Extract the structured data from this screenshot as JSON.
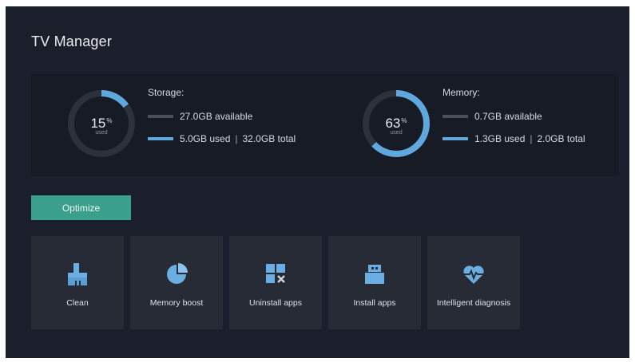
{
  "header": {
    "title": "TV Manager"
  },
  "storage": {
    "percent": "15",
    "percent_unit": "%",
    "used_label": "used",
    "fraction": 0.15,
    "heading": "Storage:",
    "available": "27.0GB available",
    "used": "5.0GB used",
    "separator": "|",
    "total": "32.0GB total"
  },
  "memory": {
    "percent": "63",
    "percent_unit": "%",
    "used_label": "used",
    "fraction": 0.63,
    "heading": "Memory:",
    "available": "0.7GB available",
    "used": "1.3GB used",
    "separator": "|",
    "total": "2.0GB total"
  },
  "actions": {
    "optimize_label": "Optimize"
  },
  "tiles": [
    {
      "label": "Clean",
      "icon": "broom-icon"
    },
    {
      "label": "Memory boost",
      "icon": "pie-chart-icon"
    },
    {
      "label": "Uninstall apps",
      "icon": "uninstall-grid-icon"
    },
    {
      "label": "Install apps",
      "icon": "usb-drive-icon"
    },
    {
      "label": "Intelligent diagnosis",
      "icon": "heart-pulse-icon"
    }
  ],
  "colors": {
    "background": "#1b1f2b",
    "panel": "#171b26",
    "tile": "#262b36",
    "accent_blue": "#5fa7dd",
    "optimize_green": "#3aa08c",
    "icon_blue": "#6aaee3"
  }
}
